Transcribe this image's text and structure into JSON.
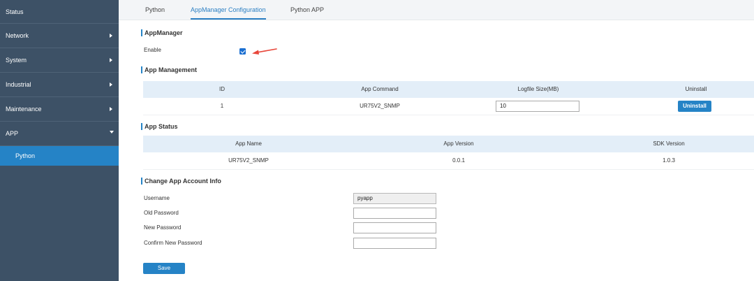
{
  "sidebar": {
    "items": [
      {
        "label": "Status"
      },
      {
        "label": "Network"
      },
      {
        "label": "System"
      },
      {
        "label": "Industrial"
      },
      {
        "label": "Maintenance"
      },
      {
        "label": "APP"
      }
    ],
    "sub_items": [
      {
        "label": "Python"
      }
    ]
  },
  "tabs": [
    {
      "label": "Python"
    },
    {
      "label": "AppManager Configuration",
      "active": true
    },
    {
      "label": "Python APP"
    }
  ],
  "app_manager": {
    "title": "AppManager",
    "enable_label": "Enable",
    "enable_checked": true
  },
  "app_management": {
    "title": "App Management",
    "headers": [
      "ID",
      "App Command",
      "Logfile Size(MB)",
      "Uninstall"
    ],
    "rows": [
      {
        "id": "1",
        "command": "UR75V2_SNMP",
        "logfile_size": "10",
        "uninstall_label": "Uninstall"
      }
    ]
  },
  "app_status": {
    "title": "App Status",
    "headers": [
      "App Name",
      "App Version",
      "SDK Version"
    ],
    "rows": [
      {
        "name": "UR75V2_SNMP",
        "version": "0.0.1",
        "sdk": "1.0.3"
      }
    ]
  },
  "account": {
    "title": "Change App Account Info",
    "username_label": "Username",
    "username_value": "pyapp",
    "old_password_label": "Old Password",
    "old_password_value": "",
    "new_password_label": "New Password",
    "new_password_value": "",
    "confirm_password_label": "Confirm New Password",
    "confirm_password_value": ""
  },
  "save_label": "Save",
  "colors": {
    "sidebar_bg": "#3d5166",
    "accent": "#2583c6",
    "table_header_bg": "#e3eef8",
    "annotation_arrow": "#e8463a"
  }
}
